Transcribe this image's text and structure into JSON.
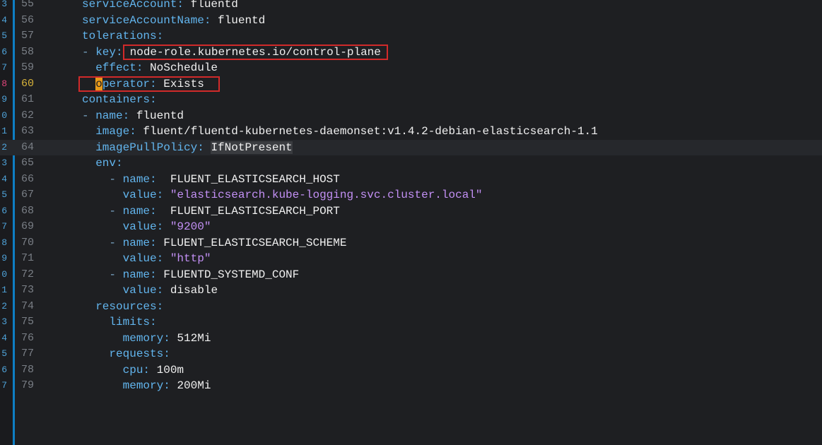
{
  "editor": {
    "lines": [
      {
        "rel": "3",
        "num": "55",
        "key": "serviceAccount",
        "sep": ": ",
        "val": "fluentd",
        "dash": "",
        "indent": "",
        "kind": "plain"
      },
      {
        "rel": "4",
        "num": "56",
        "key": "serviceAccountName",
        "sep": ": ",
        "val": "fluentd",
        "dash": "",
        "indent": "",
        "kind": "plain"
      },
      {
        "rel": "5",
        "num": "57",
        "key": "tolerations",
        "sep": ":",
        "val": "",
        "dash": "",
        "indent": "",
        "kind": "plain"
      },
      {
        "rel": "6",
        "num": "58",
        "key": "key",
        "sep": ":",
        "val": "node-role.kubernetes.io/control-plane",
        "dash": "- ",
        "indent": "",
        "kind": "boxed"
      },
      {
        "rel": "7",
        "num": "59",
        "key": "effect",
        "sep": ": ",
        "val": "NoSchedule",
        "dash": "",
        "indent": "  ",
        "kind": "plain"
      },
      {
        "rel": "8",
        "num": "60",
        "key": "perator",
        "caret": "o",
        "sep": ": ",
        "val": "Exists",
        "dash": "",
        "indent": "  ",
        "kind": "caret"
      },
      {
        "rel": "9",
        "num": "61",
        "key": "containers",
        "sep": ":",
        "val": "",
        "dash": "",
        "indent": "",
        "kind": "plain"
      },
      {
        "rel": "0",
        "num": "62",
        "key": "name",
        "sep": ": ",
        "val": "fluentd",
        "dash": "- ",
        "indent": "",
        "kind": "plain"
      },
      {
        "rel": "1",
        "num": "63",
        "key": "image",
        "sep": ": ",
        "val": "fluent/fluentd-kubernetes-daemonset:v1.4.2-debian-elasticsearch-1.1",
        "dash": "",
        "indent": "  ",
        "kind": "plain"
      },
      {
        "rel": "2",
        "num": "64",
        "key": "imagePullPolicy",
        "sep": ": ",
        "val": "IfNotPresent",
        "dash": "",
        "indent": "  ",
        "kind": "selected"
      },
      {
        "rel": "3",
        "num": "65",
        "key": "env",
        "sep": ":",
        "val": "",
        "dash": "",
        "indent": "  ",
        "kind": "plain"
      },
      {
        "rel": "4",
        "num": "66",
        "key": "name",
        "sep": ":  ",
        "val": "FLUENT_ELASTICSEARCH_HOST",
        "dash": "- ",
        "indent": "    ",
        "kind": "plain"
      },
      {
        "rel": "5",
        "num": "67",
        "key": "value",
        "sep": ": ",
        "val": "\"elasticsearch.kube-logging.svc.cluster.local\"",
        "dash": "",
        "indent": "      ",
        "kind": "string"
      },
      {
        "rel": "6",
        "num": "68",
        "key": "name",
        "sep": ":  ",
        "val": "FLUENT_ELASTICSEARCH_PORT",
        "dash": "- ",
        "indent": "    ",
        "kind": "plain"
      },
      {
        "rel": "7",
        "num": "69",
        "key": "value",
        "sep": ": ",
        "val": "\"9200\"",
        "dash": "",
        "indent": "      ",
        "kind": "string"
      },
      {
        "rel": "8",
        "num": "70",
        "key": "name",
        "sep": ": ",
        "val": "FLUENT_ELASTICSEARCH_SCHEME",
        "dash": "- ",
        "indent": "    ",
        "kind": "plain"
      },
      {
        "rel": "9",
        "num": "71",
        "key": "value",
        "sep": ": ",
        "val": "\"http\"",
        "dash": "",
        "indent": "      ",
        "kind": "string"
      },
      {
        "rel": "0",
        "num": "72",
        "key": "name",
        "sep": ": ",
        "val": "FLUENTD_SYSTEMD_CONF",
        "dash": "- ",
        "indent": "    ",
        "kind": "plain"
      },
      {
        "rel": "1",
        "num": "73",
        "key": "value",
        "sep": ": ",
        "val": "disable",
        "dash": "",
        "indent": "      ",
        "kind": "plain"
      },
      {
        "rel": "2",
        "num": "74",
        "key": "resources",
        "sep": ":",
        "val": "",
        "dash": "",
        "indent": "  ",
        "kind": "plain"
      },
      {
        "rel": "3",
        "num": "75",
        "key": "limits",
        "sep": ":",
        "val": "",
        "dash": "",
        "indent": "    ",
        "kind": "plain"
      },
      {
        "rel": "4",
        "num": "76",
        "key": "memory",
        "sep": ": ",
        "val": "512Mi",
        "dash": "",
        "indent": "      ",
        "kind": "plain"
      },
      {
        "rel": "5",
        "num": "77",
        "key": "requests",
        "sep": ":",
        "val": "",
        "dash": "",
        "indent": "    ",
        "kind": "plain"
      },
      {
        "rel": "6",
        "num": "78",
        "key": "cpu",
        "sep": ": ",
        "val": "100m",
        "dash": "",
        "indent": "      ",
        "kind": "plain"
      },
      {
        "rel": "7",
        "num": "79",
        "key": "memory",
        "sep": ": ",
        "val": "200Mi",
        "dash": "",
        "indent": "      ",
        "kind": "plain"
      }
    ],
    "current_line": "64",
    "cursor_line": "60",
    "colors": {
      "background": "#1e1f22",
      "key": "#62b5ee",
      "string": "#c390f5",
      "highlight_box": "#d12a2a",
      "cursor": "#e89a1a",
      "gutter_accent": "#0e7fc4"
    }
  }
}
